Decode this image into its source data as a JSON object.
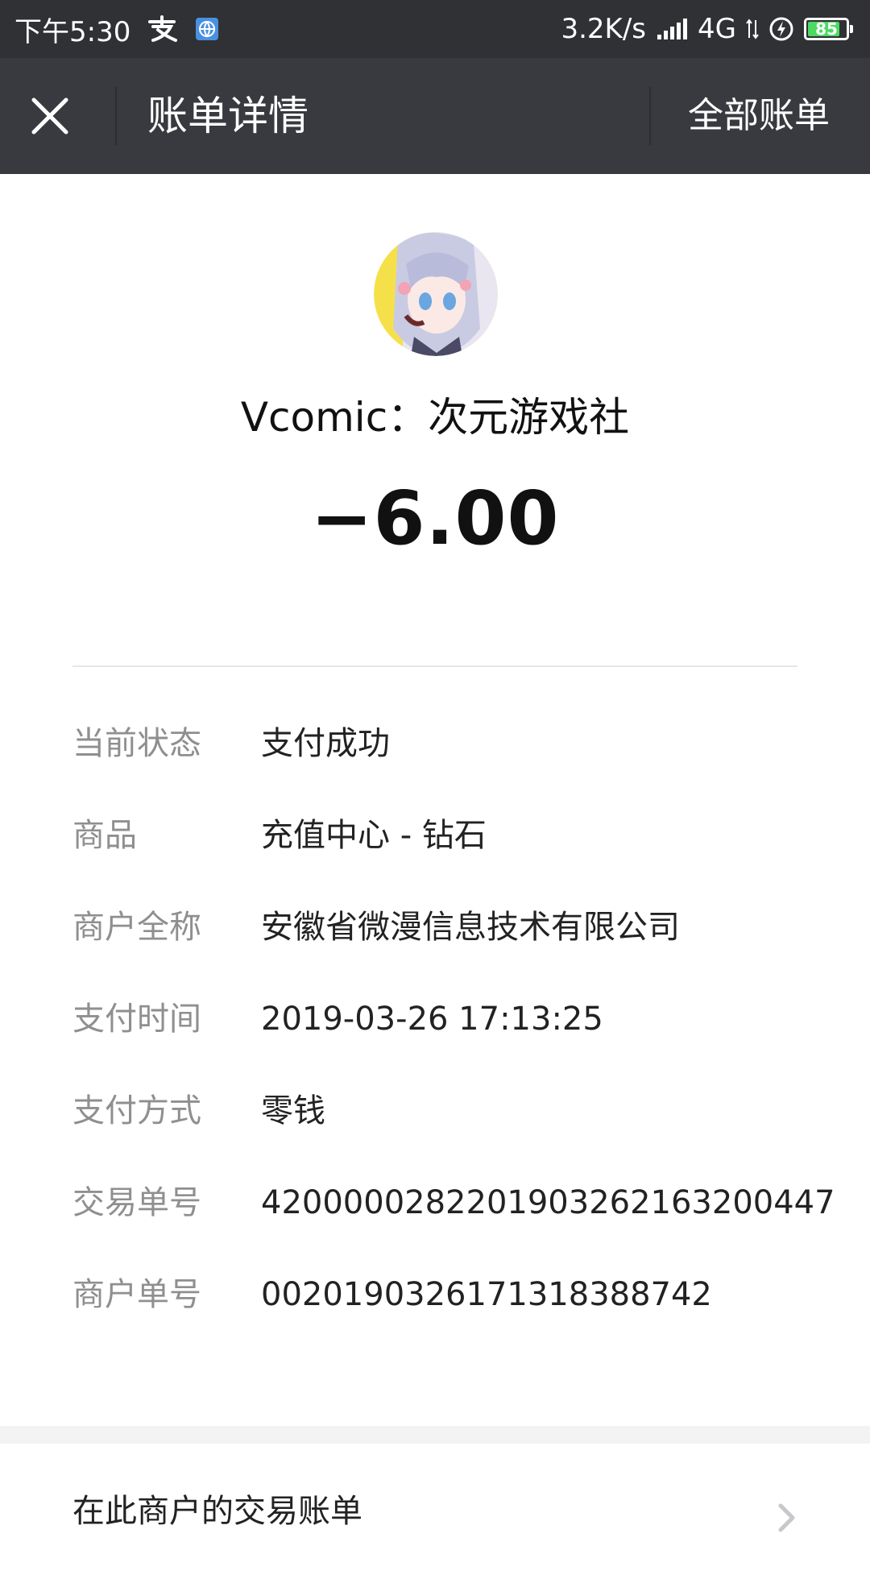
{
  "status_bar": {
    "time": "下午5:30",
    "alipay_icon": "alipay-icon",
    "browser_icon": "globe-icon",
    "network_speed": "3.2K/s",
    "network_type": "4G",
    "battery_level": "85",
    "battery_fraction": 0.85,
    "battery_color": "#4cd964"
  },
  "nav": {
    "close_icon": "close-icon",
    "title": "账单详情",
    "action": "全部账单"
  },
  "merchant": {
    "name": "Vcomic：次元游戏社",
    "amount": "−6.00"
  },
  "details": [
    {
      "label": "当前状态",
      "value": "支付成功"
    },
    {
      "label": "商品",
      "value": "充值中心 - 钻石"
    },
    {
      "label": "商户全称",
      "value": "安徽省微漫信息技术有限公司"
    },
    {
      "label": "支付时间",
      "value": "2019-03-26 17:13:25"
    },
    {
      "label": "支付方式",
      "value": "零钱"
    },
    {
      "label": "交易单号",
      "value": "4200000282201903262163200447"
    },
    {
      "label": "商户单号",
      "value": "0020190326171318388742"
    }
  ],
  "footer": {
    "link_label": "在此商户的交易账单",
    "chevron_icon": "chevron-right-icon"
  }
}
